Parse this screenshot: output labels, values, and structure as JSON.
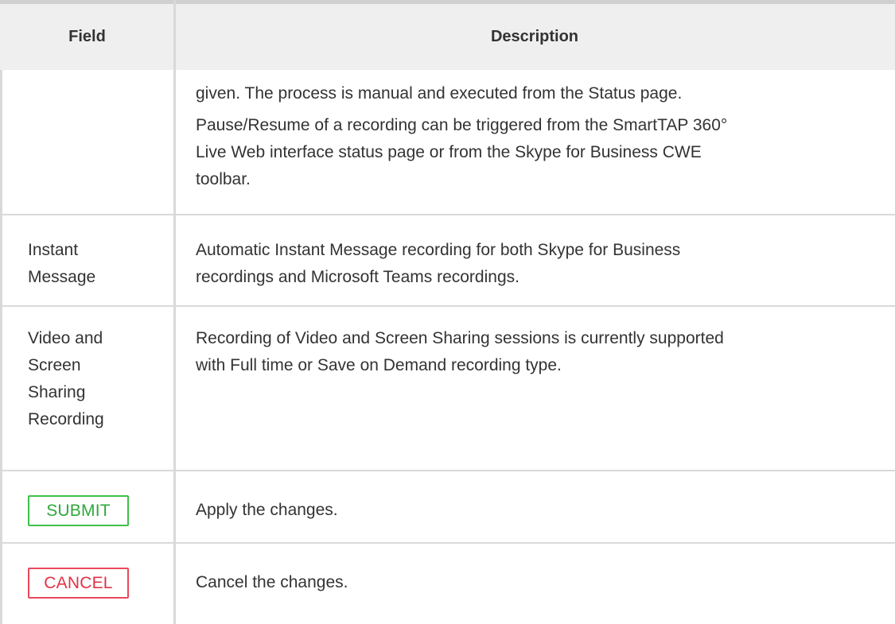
{
  "table": {
    "headers": {
      "field": "Field",
      "description": "Description"
    },
    "rows": [
      {
        "field": "",
        "description_lines": [
          "given. The process is manual and executed from the Status page.",
          "Pause/Resume of a recording can be triggered from the SmartTAP 360°",
          "Live Web interface status page or from the Skype for Business CWE",
          "toolbar."
        ]
      },
      {
        "field_lines": [
          "Instant",
          "Message"
        ],
        "description_lines": [
          "Automatic Instant Message recording for both Skype for Business",
          "recordings and Microsoft Teams recordings."
        ]
      },
      {
        "field_lines": [
          "Video and",
          "Screen",
          "Sharing",
          "Recording"
        ],
        "description_lines": [
          "Recording of Video and Screen Sharing sessions is currently supported",
          "with Full time or Save on Demand recording type."
        ]
      },
      {
        "button_label": "SUBMIT",
        "description": "Apply the changes."
      },
      {
        "button_label": "CANCEL",
        "description": "Cancel the changes."
      }
    ]
  },
  "colors": {
    "header_bg": "#efefef",
    "border": "#d9d9d9",
    "submit": "#3fbf4b",
    "cancel": "#e8485a",
    "text": "#333333"
  }
}
